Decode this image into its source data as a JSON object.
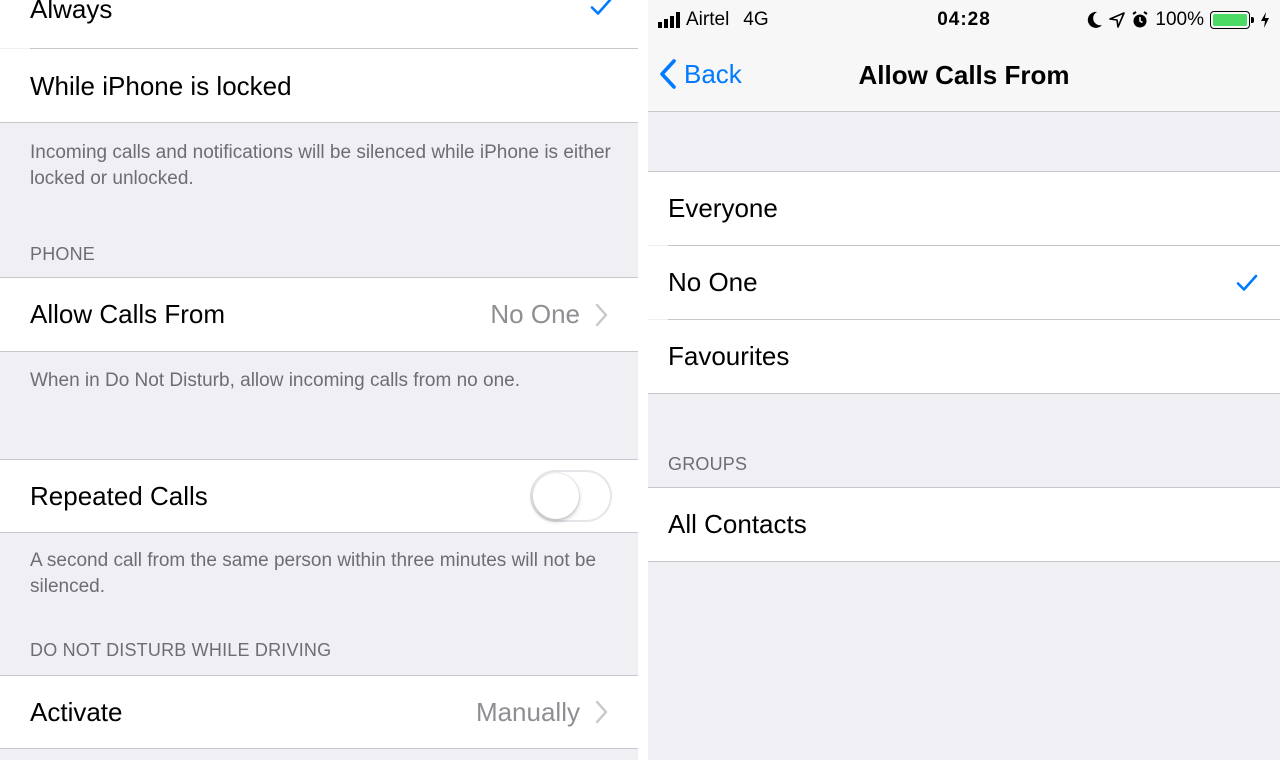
{
  "left": {
    "rows": {
      "always": "Always",
      "while_locked": "While iPhone is locked",
      "allow_calls_from": "Allow Calls From",
      "allow_calls_value": "No One",
      "repeated_calls": "Repeated Calls",
      "activate": "Activate",
      "activate_value": "Manually"
    },
    "footers": {
      "silence_info": "Incoming calls and notifications will be silenced while iPhone is either locked or unlocked.",
      "allow_calls_info": "When in Do Not Disturb, allow incoming calls from no one.",
      "repeated_calls_info": "A second call from the same person within three minutes will not be silenced."
    },
    "headers": {
      "phone": "PHONE",
      "driving": "DO NOT DISTURB WHILE DRIVING"
    },
    "repeated_calls_enabled": false
  },
  "right": {
    "status": {
      "carrier": "Airtel",
      "network": "4G",
      "time": "04:28",
      "battery": "100%"
    },
    "nav": {
      "back_label": "Back",
      "title": "Allow Calls From"
    },
    "options": [
      "Everyone",
      "No One",
      "Favourites"
    ],
    "selected_option": "No One",
    "groups_header": "GROUPS",
    "groups": [
      "All Contacts"
    ]
  },
  "colors": {
    "accent": "#007aff",
    "background": "#efeff4",
    "battery": "#4cd964",
    "secondary_text": "#8e8e93"
  }
}
